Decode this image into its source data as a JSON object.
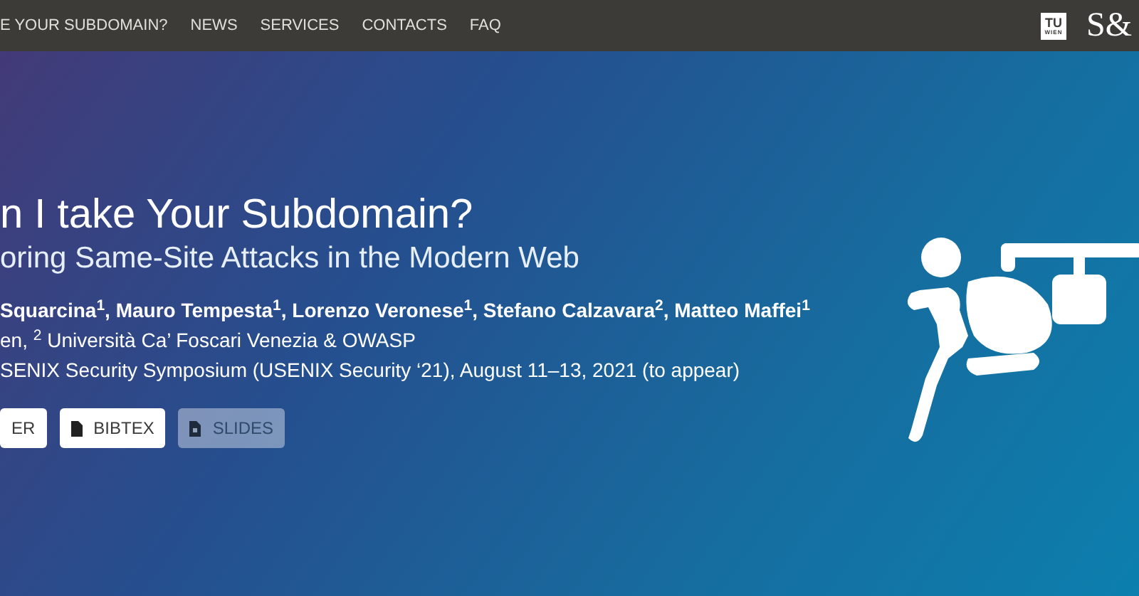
{
  "nav": {
    "items": [
      "E YOUR SUBDOMAIN?",
      "NEWS",
      "SERVICES",
      "CONTACTS",
      "FAQ"
    ],
    "logo_badge": {
      "top": "TU",
      "bottom": "WIEN"
    },
    "logo_text": "S&"
  },
  "hero": {
    "title": "n I take Your Subdomain?",
    "subtitle": "oring Same-Site Attacks in the Modern Web",
    "authors": "Squarcina$^{1}$, Mauro Tempesta$^{1}$, Lorenzo Veronese$^{1}$, Stefano Calzavara$^{2}$, Matteo Maffei$^{1}$",
    "affiliations": "en, $^{2}$ Università Ca’ Foscari Venezia & OWASP",
    "venue": "SENIX Security Symposium (USENIX Security ‘21), August 11–13, 2021 (to appear)",
    "buttons": [
      {
        "label": "ER",
        "kind": "plain",
        "disabled": false
      },
      {
        "label": "BIBTEX",
        "kind": "file",
        "disabled": false
      },
      {
        "label": "SLIDES",
        "kind": "slides",
        "disabled": true
      }
    ]
  }
}
